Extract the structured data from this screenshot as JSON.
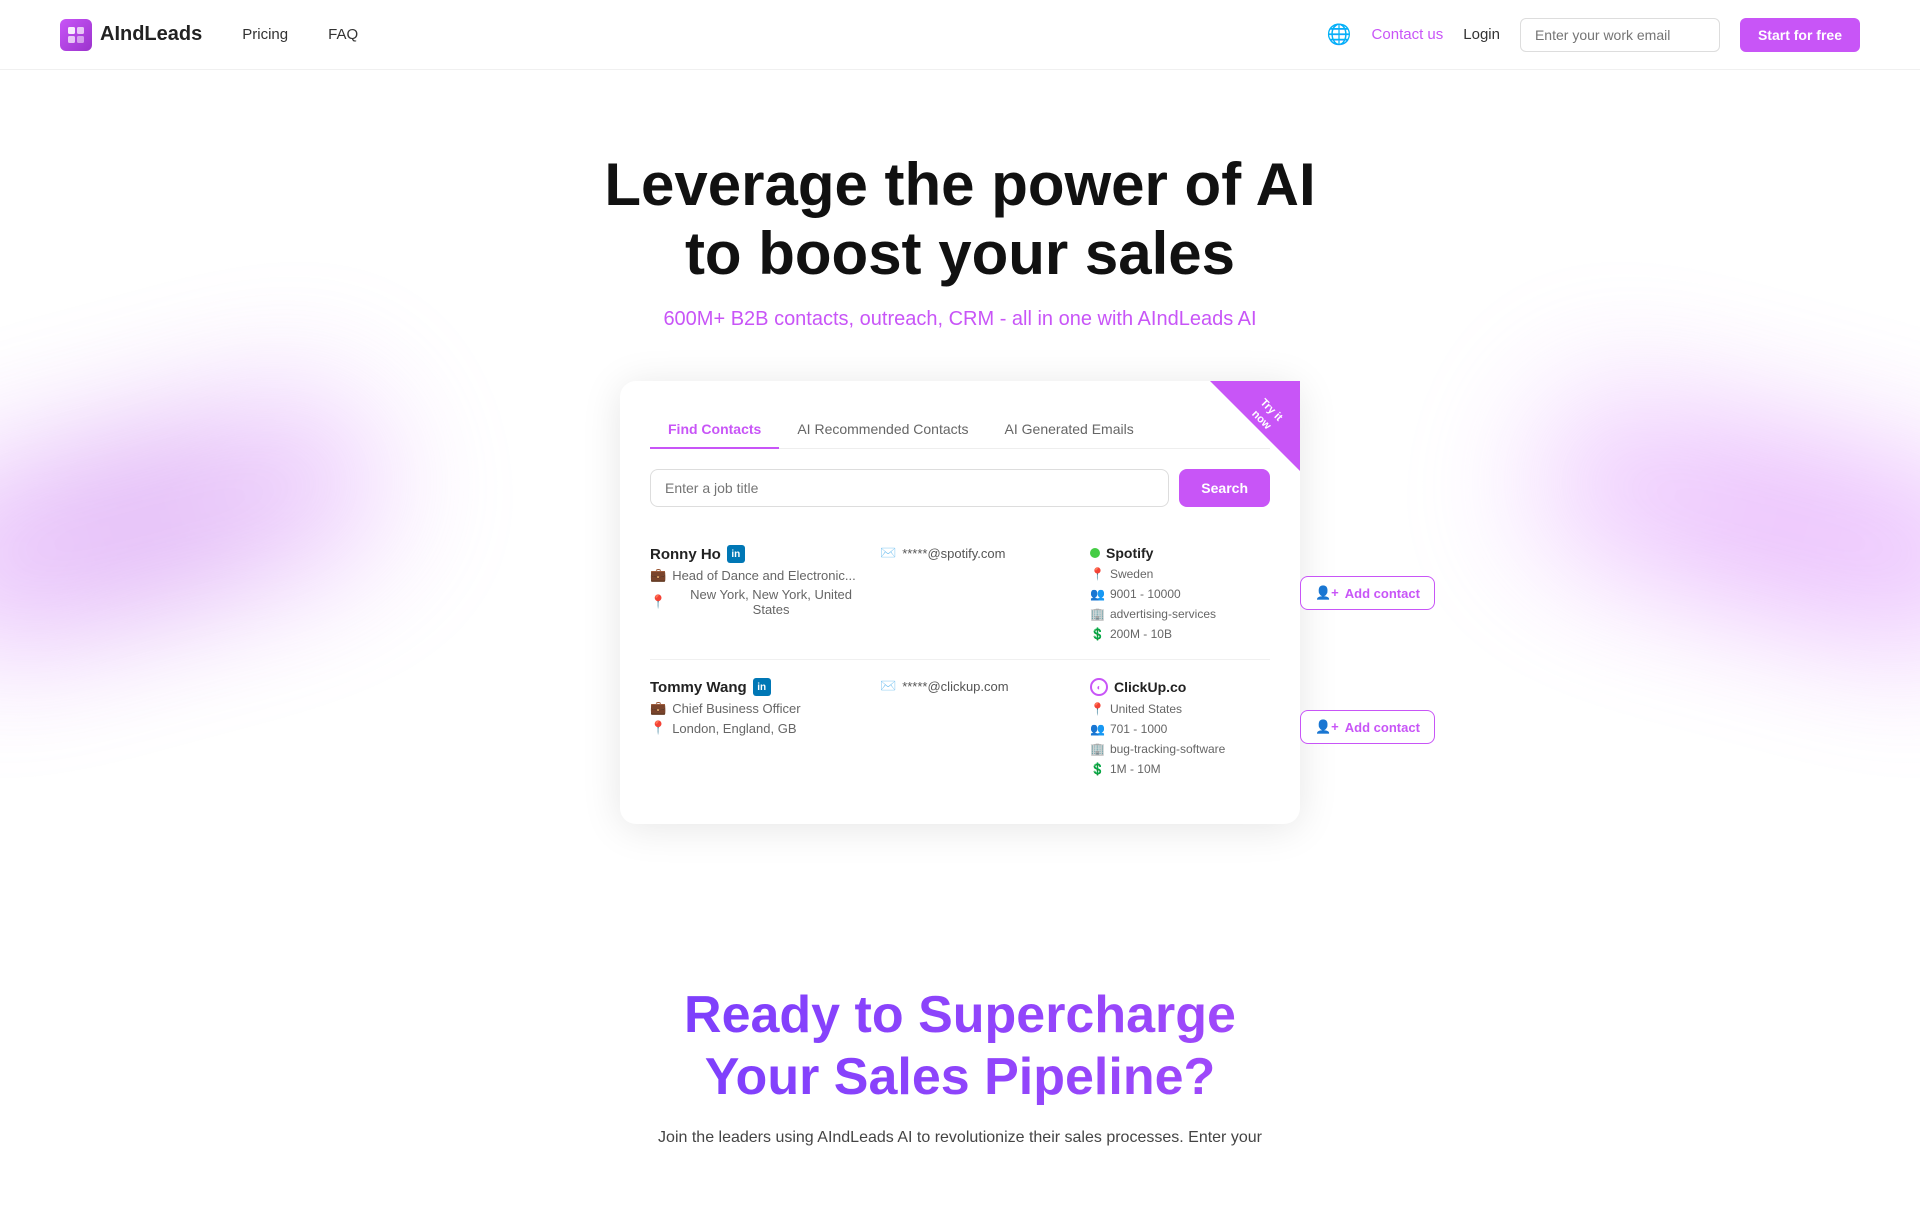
{
  "navbar": {
    "logo_text": "AIndLeads",
    "logo_icon": "AI",
    "nav_links": [
      {
        "label": "Pricing",
        "id": "pricing"
      },
      {
        "label": "FAQ",
        "id": "faq"
      }
    ],
    "contact_label": "Contact us",
    "login_label": "Login",
    "email_placeholder": "Enter your work email",
    "start_label": "Start for free"
  },
  "hero": {
    "title_line1": "Leverage the power of AI",
    "title_line2": "to boost your sales",
    "subtitle": "600M+ B2B contacts, outreach, CRM - all in one with AIndLeads AI"
  },
  "card": {
    "try_badge": "Try it\nnow",
    "tabs": [
      {
        "label": "Find Contacts",
        "active": true
      },
      {
        "label": "AI Recommended Contacts",
        "active": false
      },
      {
        "label": "AI Generated Emails",
        "active": false
      }
    ],
    "search_placeholder": "Enter a job title",
    "search_label": "Search",
    "contacts": [
      {
        "name": "Ronny Ho",
        "has_linkedin": true,
        "email_masked": "*****@spotify.com",
        "title": "Head of Dance and Electronic...",
        "location": "New York, New York, United States",
        "company_name": "Spotify",
        "company_active": true,
        "company_country": "Sweden",
        "company_size": "9001 - 10000",
        "company_revenue": "200M - 10B",
        "company_industry": "advertising-services",
        "add_label": "Add contact"
      },
      {
        "name": "Tommy Wang",
        "has_linkedin": true,
        "email_masked": "*****@clickup.com",
        "title": "Chief Business Officer",
        "location": "London, England, GB",
        "company_name": "ClickUp.co",
        "company_active": false,
        "company_country": "United States",
        "company_size": "701 - 1000",
        "company_revenue": "1M - 10M",
        "company_industry": "bug-tracking-software",
        "add_label": "Add contact"
      }
    ]
  },
  "bottom": {
    "title_line1": "Ready to Supercharge",
    "title_line2": "Your Sales Pipeline?",
    "description": "Join the leaders using AIndLeads AI to revolutionize their sales processes. Enter your"
  }
}
